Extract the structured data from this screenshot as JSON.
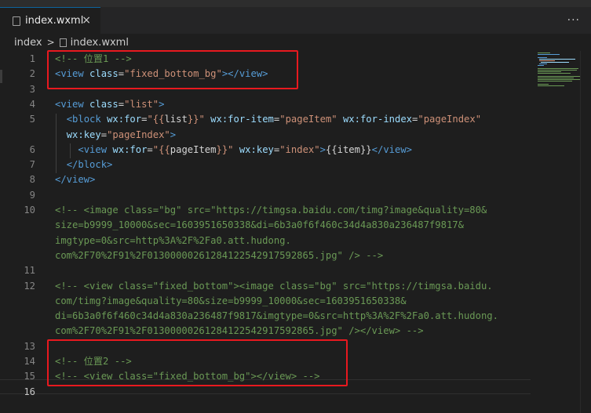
{
  "tab": {
    "filename": "index.wxml",
    "close_label": "×"
  },
  "toolbar": {
    "more_label": "···"
  },
  "breadcrumb": {
    "folder": "index",
    "separator": ">",
    "file": "index.wxml"
  },
  "lines": [
    {
      "n": "1",
      "segments": [
        [
          "com",
          "<!-- 位置1 -->"
        ]
      ]
    },
    {
      "n": "2",
      "segments": [
        [
          "tag",
          "<view"
        ],
        [
          "txt",
          " "
        ],
        [
          "attr",
          "class"
        ],
        [
          "txt",
          "="
        ],
        [
          "str",
          "\"fixed_bottom_bg\""
        ],
        [
          "tag",
          ">"
        ],
        [
          "tag",
          "</view>"
        ]
      ]
    },
    {
      "n": "3",
      "segments": []
    },
    {
      "n": "4",
      "segments": [
        [
          "tag",
          "<view"
        ],
        [
          "txt",
          " "
        ],
        [
          "attr",
          "class"
        ],
        [
          "txt",
          "="
        ],
        [
          "str",
          "\"list\""
        ],
        [
          "tag",
          ">"
        ]
      ]
    },
    {
      "n": "5",
      "segments": [
        [
          "txt",
          "  "
        ],
        [
          "tag",
          "<block"
        ],
        [
          "txt",
          " "
        ],
        [
          "attr",
          "wx:for"
        ],
        [
          "txt",
          "="
        ],
        [
          "str",
          "\"{{"
        ],
        [
          "txt",
          "list"
        ],
        [
          "str",
          "}}\""
        ],
        [
          "txt",
          " "
        ],
        [
          "attr",
          "wx:for-item"
        ],
        [
          "txt",
          "="
        ],
        [
          "str",
          "\"pageItem\""
        ],
        [
          "txt",
          " "
        ],
        [
          "attr",
          "wx:for-index"
        ],
        [
          "txt",
          "="
        ],
        [
          "str",
          "\"pageIndex\""
        ]
      ]
    },
    {
      "n": "",
      "segments": [
        [
          "txt",
          "  "
        ],
        [
          "attr",
          "wx:key"
        ],
        [
          "txt",
          "="
        ],
        [
          "str",
          "\"pageIndex\""
        ],
        [
          "tag",
          ">"
        ]
      ]
    },
    {
      "n": "6",
      "segments": [
        [
          "txt",
          "    "
        ],
        [
          "tag",
          "<view"
        ],
        [
          "txt",
          " "
        ],
        [
          "attr",
          "wx:for"
        ],
        [
          "txt",
          "="
        ],
        [
          "str",
          "\"{{"
        ],
        [
          "txt",
          "pageItem"
        ],
        [
          "str",
          "}}\""
        ],
        [
          "txt",
          " "
        ],
        [
          "attr",
          "wx:key"
        ],
        [
          "txt",
          "="
        ],
        [
          "str",
          "\"index\""
        ],
        [
          "tag",
          ">"
        ],
        [
          "txt",
          "{{item}}"
        ],
        [
          "tag",
          "</view>"
        ]
      ]
    },
    {
      "n": "7",
      "segments": [
        [
          "txt",
          "  "
        ],
        [
          "tag",
          "</block>"
        ]
      ]
    },
    {
      "n": "8",
      "segments": [
        [
          "tag",
          "</view>"
        ]
      ]
    },
    {
      "n": "9",
      "segments": []
    },
    {
      "n": "10",
      "segments": [
        [
          "com",
          "<!-- <image class=\"bg\" src=\"https://timgsa.baidu.com/timg?image&quality=80&"
        ]
      ]
    },
    {
      "n": "",
      "segments": [
        [
          "com",
          "size=b9999_10000&sec=1603951650338&di=6b3a0f6f460c34d4a830a236487f9817&"
        ]
      ]
    },
    {
      "n": "",
      "segments": [
        [
          "com",
          "imgtype=0&src=http%3A%2F%2Fa0.att.hudong."
        ]
      ]
    },
    {
      "n": "",
      "segments": [
        [
          "com",
          "com%2F70%2F91%2F01300000261284122542917592865.jpg\" /> -->"
        ]
      ]
    },
    {
      "n": "11",
      "segments": []
    },
    {
      "n": "12",
      "segments": [
        [
          "com",
          "<!-- <view class=\"fixed_bottom\"><image class=\"bg\" src=\"https://timgsa.baidu."
        ]
      ]
    },
    {
      "n": "",
      "segments": [
        [
          "com",
          "com/timg?image&quality=80&size=b9999_10000&sec=1603951650338&"
        ]
      ]
    },
    {
      "n": "",
      "segments": [
        [
          "com",
          "di=6b3a0f6f460c34d4a830a236487f9817&imgtype=0&src=http%3A%2F%2Fa0.att.hudong."
        ]
      ]
    },
    {
      "n": "",
      "segments": [
        [
          "com",
          "com%2F70%2F91%2F01300000261284122542917592865.jpg\" /></view> -->"
        ]
      ]
    },
    {
      "n": "13",
      "segments": []
    },
    {
      "n": "14",
      "segments": [
        [
          "com",
          "<!-- 位置2 -->"
        ]
      ]
    },
    {
      "n": "15",
      "segments": [
        [
          "com",
          "<!-- <view class=\"fixed_bottom_bg\"></view> -->"
        ]
      ]
    },
    {
      "n": "16",
      "segments": []
    }
  ],
  "colors": {
    "tag": "#569cd6",
    "attr": "#9cdcfe",
    "string": "#ce9178",
    "text": "#d4d4d4",
    "comment": "#6a9955",
    "highlight_box": "#e8191f"
  }
}
